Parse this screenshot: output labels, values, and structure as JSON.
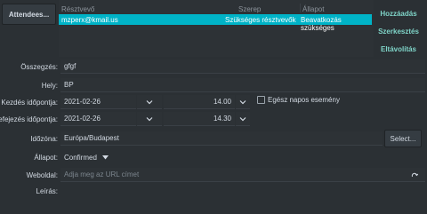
{
  "attendees": {
    "button_label": "Attendees...",
    "columns": [
      "Résztvevő",
      "Szerep",
      "Állapot"
    ],
    "rows": [
      {
        "name": "mzperx@kmail.us",
        "role": "Szükséges résztvevők",
        "status": "Beavatkozás szükséges"
      }
    ],
    "actions": {
      "add": "Hozzáadás",
      "edit": "Szerkesztés",
      "remove": "Eltávolítás"
    }
  },
  "form": {
    "summary_label": "Összegzés:",
    "summary_value": "gfgf",
    "location_label": "Hely:",
    "location_value": "BP",
    "start_label": "Kezdés időpontja:",
    "start_date": "2021-02-26",
    "start_time": "14.00",
    "allday_label": "Egész napos esemény",
    "end_label": "Befejezés időpontja:",
    "end_date": "2021-02-26",
    "end_time": "14.30",
    "timezone_label": "Időzóna:",
    "timezone_value": "Európa/Budapest",
    "select_button": "Select...",
    "status_label": "Állapot:",
    "status_value": "Confirmed",
    "website_label": "Weboldal:",
    "website_placeholder": "Adja meg az URL címet",
    "description_label": "Leírás:"
  },
  "colors": {
    "selection": "#00b3c7",
    "accent": "#7fd4c8"
  }
}
